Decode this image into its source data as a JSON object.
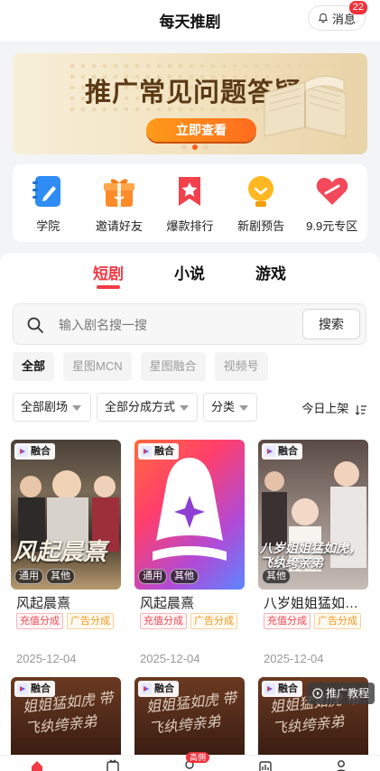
{
  "header": {
    "title": "每天推剧",
    "message_label": "消息",
    "message_count": "22"
  },
  "banner": {
    "title": "推广常见问题答疑",
    "button": "立即查看",
    "active_dot": 2,
    "dots": 3
  },
  "quick_menu": [
    {
      "label": "学院",
      "icon": "notebook-icon"
    },
    {
      "label": "邀请好友",
      "icon": "gift-icon"
    },
    {
      "label": "爆款排行",
      "icon": "ranking-icon"
    },
    {
      "label": "新剧预告",
      "icon": "bulb-icon"
    },
    {
      "label": "9.9元专区",
      "icon": "heart-tag-icon"
    }
  ],
  "tabs": [
    {
      "label": "短剧",
      "active": true
    },
    {
      "label": "小说",
      "active": false
    },
    {
      "label": "游戏",
      "active": false
    }
  ],
  "search": {
    "placeholder": "输入剧名搜一搜",
    "button": "搜索"
  },
  "chips": [
    "全部",
    "星图MCN",
    "星图融合",
    "视频号"
  ],
  "filters": {
    "theater": "全部剧场",
    "share_mode": "全部分成方式",
    "category": "分类",
    "sort": "今日上架"
  },
  "cards": [
    {
      "title": "风起晨熹",
      "badge": "融合",
      "poster_tags": [
        "通用",
        "其他"
      ],
      "tags": [
        "充值分成",
        "广告分成"
      ],
      "date": "2025-12-04",
      "poster_text": "风起晨熹"
    },
    {
      "title": "风起晨熹",
      "badge": "融合",
      "poster_tags": [
        "通用",
        "其他"
      ],
      "tags": [
        "充值分成",
        "广告分成"
      ],
      "date": "2025-12-04"
    },
    {
      "title": "八岁姐姐猛如虎，飞纨绔亲弟",
      "badge": "融合",
      "poster_tags": [
        "其他"
      ],
      "tags": [
        "充值分成",
        "广告分成"
      ],
      "date": "2025-12-04",
      "poster_text": "八岁姐姐猛如虎，飞纨绔亲弟"
    }
  ],
  "cards_row2": [
    {
      "badge": "融合",
      "poster_text": "姐姐猛如虎 带飞纨绔亲弟"
    },
    {
      "badge": "融合",
      "poster_text": "姐姐猛如虎 带飞纨绔亲弟"
    },
    {
      "badge": "融合",
      "poster_text": "姐姐猛如虎 带飞纨绔亲弟"
    }
  ],
  "promo_button": "推广教程",
  "bottom_nav": {
    "hot_badge": "高佣"
  },
  "colors": {
    "accent": "#f03b46",
    "banner_button": "#ff7a1e"
  }
}
